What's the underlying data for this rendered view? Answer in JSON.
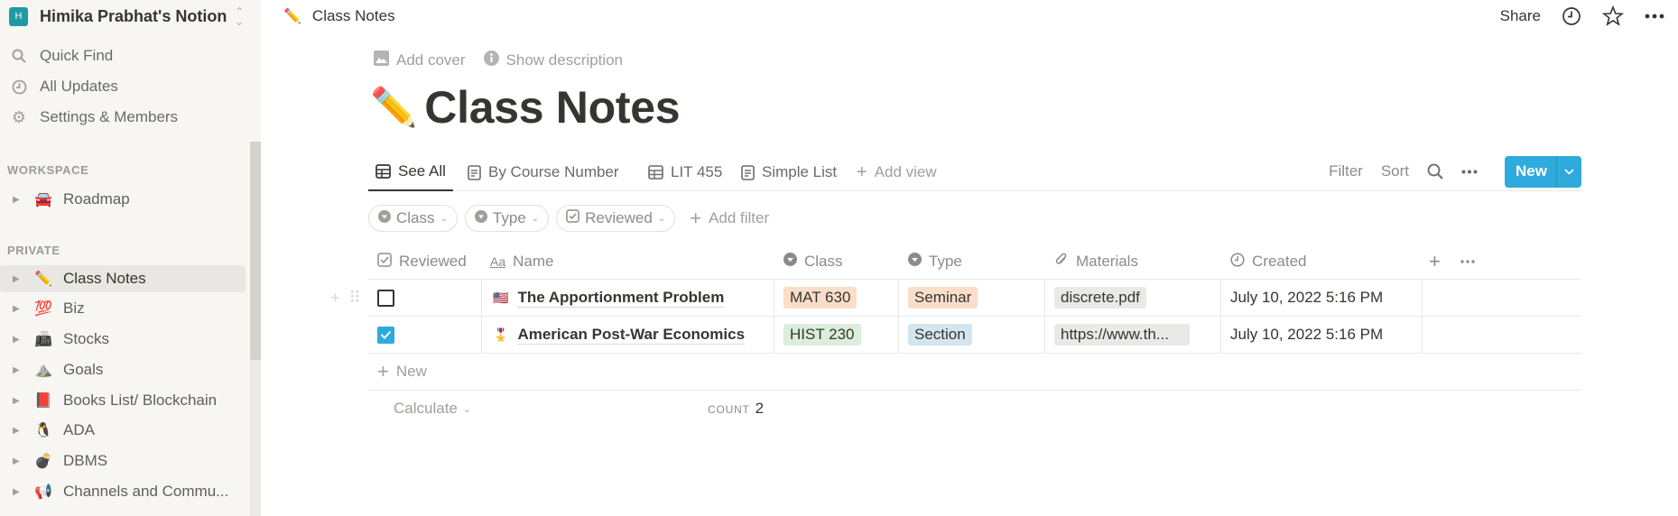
{
  "workspace": {
    "initial": "H",
    "name": "Himika Prabhat's Notion",
    "avatar_color": "#1e9ba4"
  },
  "sidebar": {
    "utilities": [
      {
        "icon": "search-icon",
        "label": "Quick Find"
      },
      {
        "icon": "clock-icon",
        "label": "All Updates"
      },
      {
        "icon": "gear-icon",
        "label": "Settings & Members"
      }
    ],
    "sections": {
      "workspace": "WORKSPACE",
      "private": "PRIVATE"
    },
    "workspace_pages": [
      {
        "emoji": "🚘",
        "label": "Roadmap"
      }
    ],
    "private_pages": [
      {
        "emoji": "✏️",
        "label": "Class Notes",
        "active": true
      },
      {
        "emoji": "💯",
        "label": "Biz"
      },
      {
        "emoji": "📠",
        "label": "Stocks"
      },
      {
        "emoji": "⛰️",
        "label": "Goals"
      },
      {
        "emoji": "📕",
        "label": "Books List/ Blockchain"
      },
      {
        "emoji": "🐧",
        "label": "ADA"
      },
      {
        "emoji": "💣",
        "label": "DBMS"
      },
      {
        "emoji": "📢",
        "label": "Channels and Commu..."
      }
    ]
  },
  "topbar": {
    "breadcrumb_emoji": "✏️",
    "breadcrumb": "Class Notes",
    "share_label": "Share",
    "icons": [
      "clock-icon",
      "star-icon",
      "more-icon"
    ]
  },
  "page": {
    "add_cover": "Add cover",
    "show_description": "Show description",
    "emoji": "✏️",
    "title": "Class Notes"
  },
  "views": {
    "tabs": [
      {
        "icon": "table-icon",
        "label": "See All",
        "active": true
      },
      {
        "icon": "list-icon",
        "label": "By Course Number"
      },
      {
        "icon": "table-icon",
        "label": "LIT 455"
      },
      {
        "icon": "list-icon",
        "label": "Simple List"
      }
    ],
    "add_view": "Add view",
    "filter": "Filter",
    "sort": "Sort",
    "new_label": "New",
    "accent": "#2eaadc"
  },
  "filters": {
    "pills": [
      {
        "icon": "select-icon",
        "label": "Class"
      },
      {
        "icon": "select-icon",
        "label": "Type"
      },
      {
        "icon": "checkbox-icon",
        "label": "Reviewed"
      }
    ],
    "add_filter": "Add filter"
  },
  "table": {
    "columns": [
      {
        "icon": "checkbox-icon",
        "label": "Reviewed"
      },
      {
        "icon": "text-icon",
        "label": "Name"
      },
      {
        "icon": "select-icon",
        "label": "Class"
      },
      {
        "icon": "select-icon",
        "label": "Type"
      },
      {
        "icon": "attachment-icon",
        "label": "Materials"
      },
      {
        "icon": "clock-icon",
        "label": "Created"
      }
    ],
    "rows": [
      {
        "reviewed": false,
        "emoji": "🇺🇸",
        "name": "The Apportionment Problem",
        "class": {
          "label": "MAT 630",
          "bg": "#fadec9"
        },
        "type": {
          "label": "Seminar",
          "bg": "#fadec9"
        },
        "materials": "discrete.pdf",
        "created": "July 10, 2022 5:16 PM"
      },
      {
        "reviewed": true,
        "emoji": "🎖️",
        "name": "American Post-War Economics",
        "class": {
          "label": "HIST 230",
          "bg": "#dbeddb"
        },
        "type": {
          "label": "Section",
          "bg": "#d3e5ef"
        },
        "materials": "https://www.th...",
        "created": "July 10, 2022 5:16 PM"
      }
    ],
    "new_row": "New",
    "calculate": "Calculate",
    "count_label": "COUNT",
    "count_value": "2"
  }
}
